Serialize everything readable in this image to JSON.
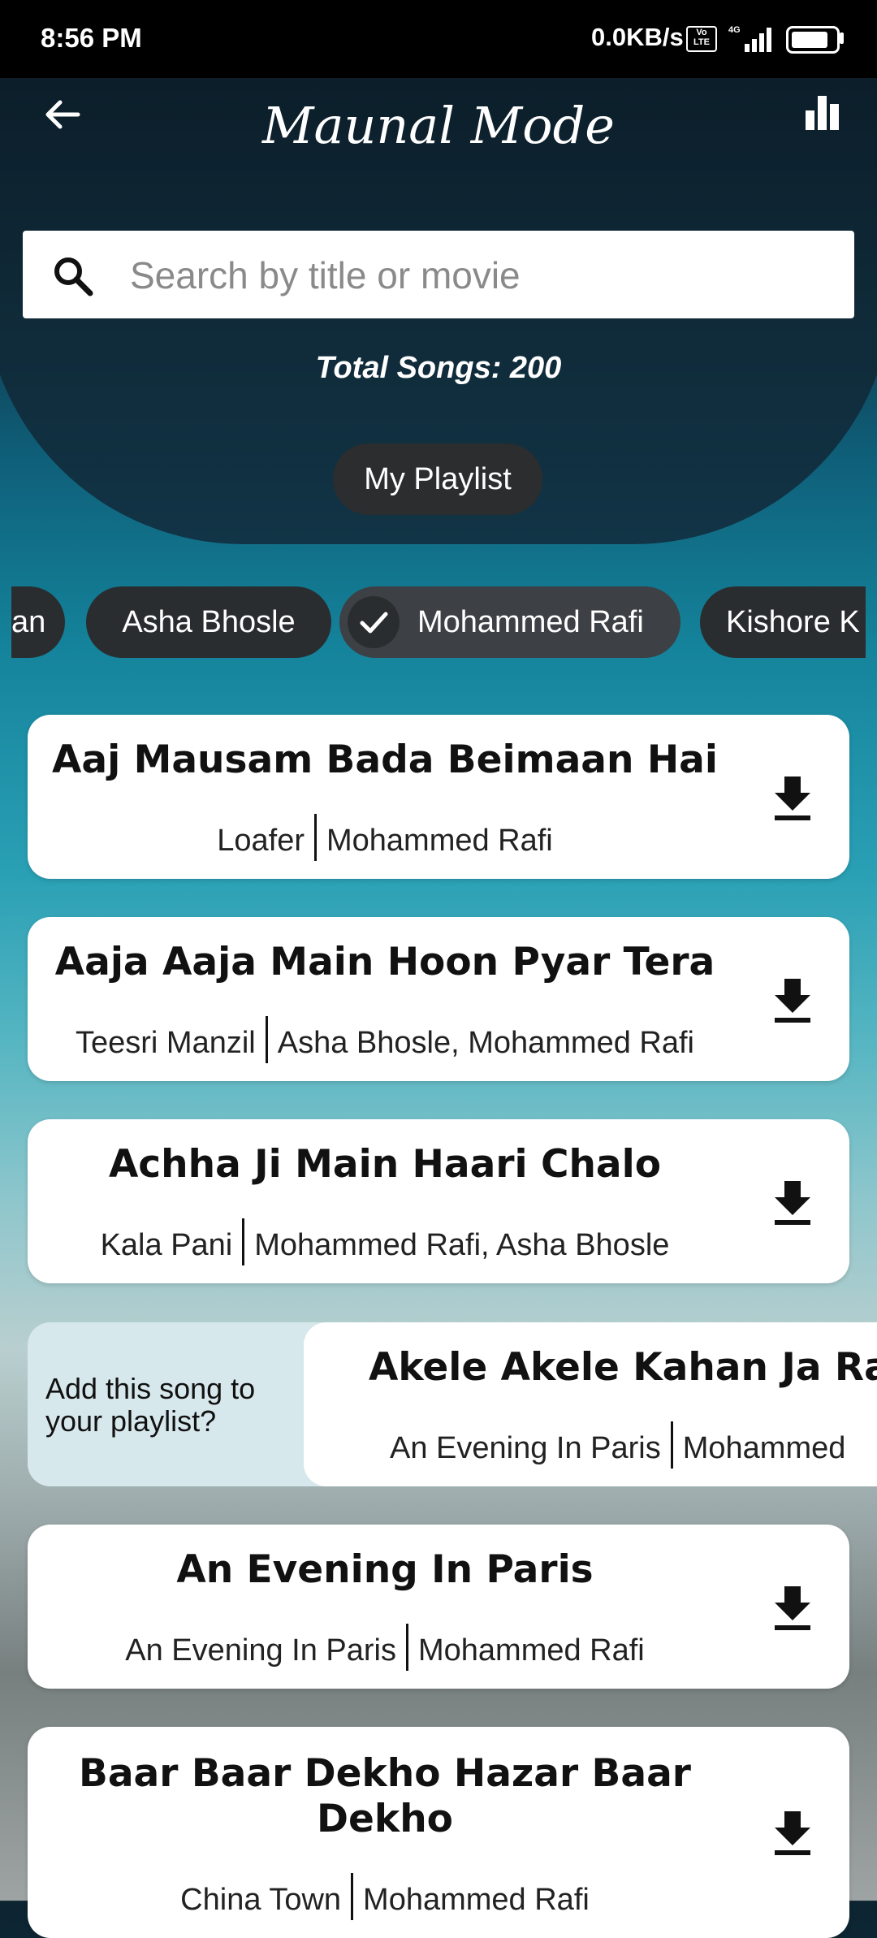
{
  "status_bar": {
    "time": "8:56 PM",
    "network_speed": "0.0KB/s",
    "volte": "Vo LTE",
    "network_type": "4G"
  },
  "header": {
    "title": "Maunal Mode"
  },
  "search": {
    "placeholder": "Search by title or movie"
  },
  "total_songs": "Total Songs: 200",
  "playlist_button": "My Playlist",
  "artist_chips": [
    {
      "label": "an",
      "selected": false
    },
    {
      "label": "Asha Bhosle",
      "selected": false
    },
    {
      "label": "Mohammed Rafi",
      "selected": true
    },
    {
      "label": "Kishore K",
      "selected": false
    }
  ],
  "songs": [
    {
      "title": "Aaj Mausam Bada Beimaan Hai",
      "movie": "Loafer",
      "artists": "Mohammed Rafi"
    },
    {
      "title": "Aaja Aaja Main Hoon Pyar Tera",
      "movie": "Teesri Manzil",
      "artists": "Asha Bhosle, Mohammed Rafi"
    },
    {
      "title": "Achha Ji Main Haari Chalo",
      "movie": "Kala Pani",
      "artists": "Mohammed Rafi, Asha Bhosle"
    },
    {
      "title": "Akele Akele Kahan Ja Rah",
      "movie": "An Evening In Paris",
      "artists": "Mohammed",
      "swiped": true,
      "swipe_prompt": "Add this song to your playlist?"
    },
    {
      "title": "An Evening In Paris",
      "movie": "An Evening In Paris",
      "artists": "Mohammed Rafi"
    },
    {
      "title": "Baar Baar Dekho Hazar Baar Dekho",
      "movie": "China Town",
      "artists": "Mohammed Rafi"
    }
  ],
  "colors": {
    "status_bar": "#000000",
    "chip_bg": "#2a2d30",
    "card_bg": "#ffffff",
    "swipe_bg": "#d7e8ec"
  },
  "icons": [
    "back-arrow-icon",
    "bar-chart-icon",
    "search-icon",
    "check-icon",
    "download-icon",
    "signal-icon",
    "battery-icon"
  ]
}
